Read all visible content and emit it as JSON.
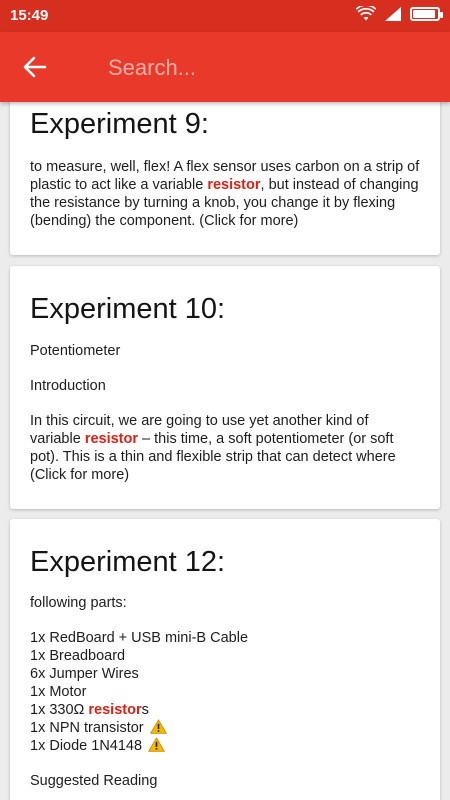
{
  "status_bar": {
    "time": "15:49",
    "icons": [
      "wifi-icon",
      "signal-icon",
      "battery-icon"
    ]
  },
  "appbar": {
    "back_icon": "arrow-left-icon",
    "search_placeholder": "Search..."
  },
  "colors": {
    "statusbar": "#d62f1f",
    "appbar": "#e8392a",
    "highlight": "#e02015",
    "warning": "#f5b800"
  },
  "results": [
    {
      "title": "Experiment 9:",
      "snippet_before": "to measure, well, flex! A flex sensor uses carbon on a strip of plastic to act like a variable ",
      "snippet_highlight": "resistor",
      "snippet_after": ", but instead of changing the resistance by turning a knob, you change it by flexing (bending) the component. (Click for more)"
    },
    {
      "title": "Experiment 10:",
      "line1": "Potentiometer",
      "line2": "Introduction",
      "snippet_before": "In this circuit, we are going to use yet another kind of variable ",
      "snippet_highlight": "resistor",
      "snippet_after": " – this time, a soft potentiometer (or soft pot). This is a thin and flexible strip that can detect where (Click for more)"
    },
    {
      "title": "Experiment 12:",
      "intro": "following parts:",
      "parts": [
        "1x RedBoard + USB mini-B Cable",
        "1x Breadboard",
        "6x Jumper Wires",
        "1x Motor"
      ],
      "part_resistor_before": "1x 330Ω ",
      "part_resistor_highlight": "resistor",
      "part_resistor_after": "s",
      "part_transistor": "1x NPN transistor",
      "part_diode": "1x Diode 1N4148",
      "suggested": "Suggested Reading"
    }
  ]
}
